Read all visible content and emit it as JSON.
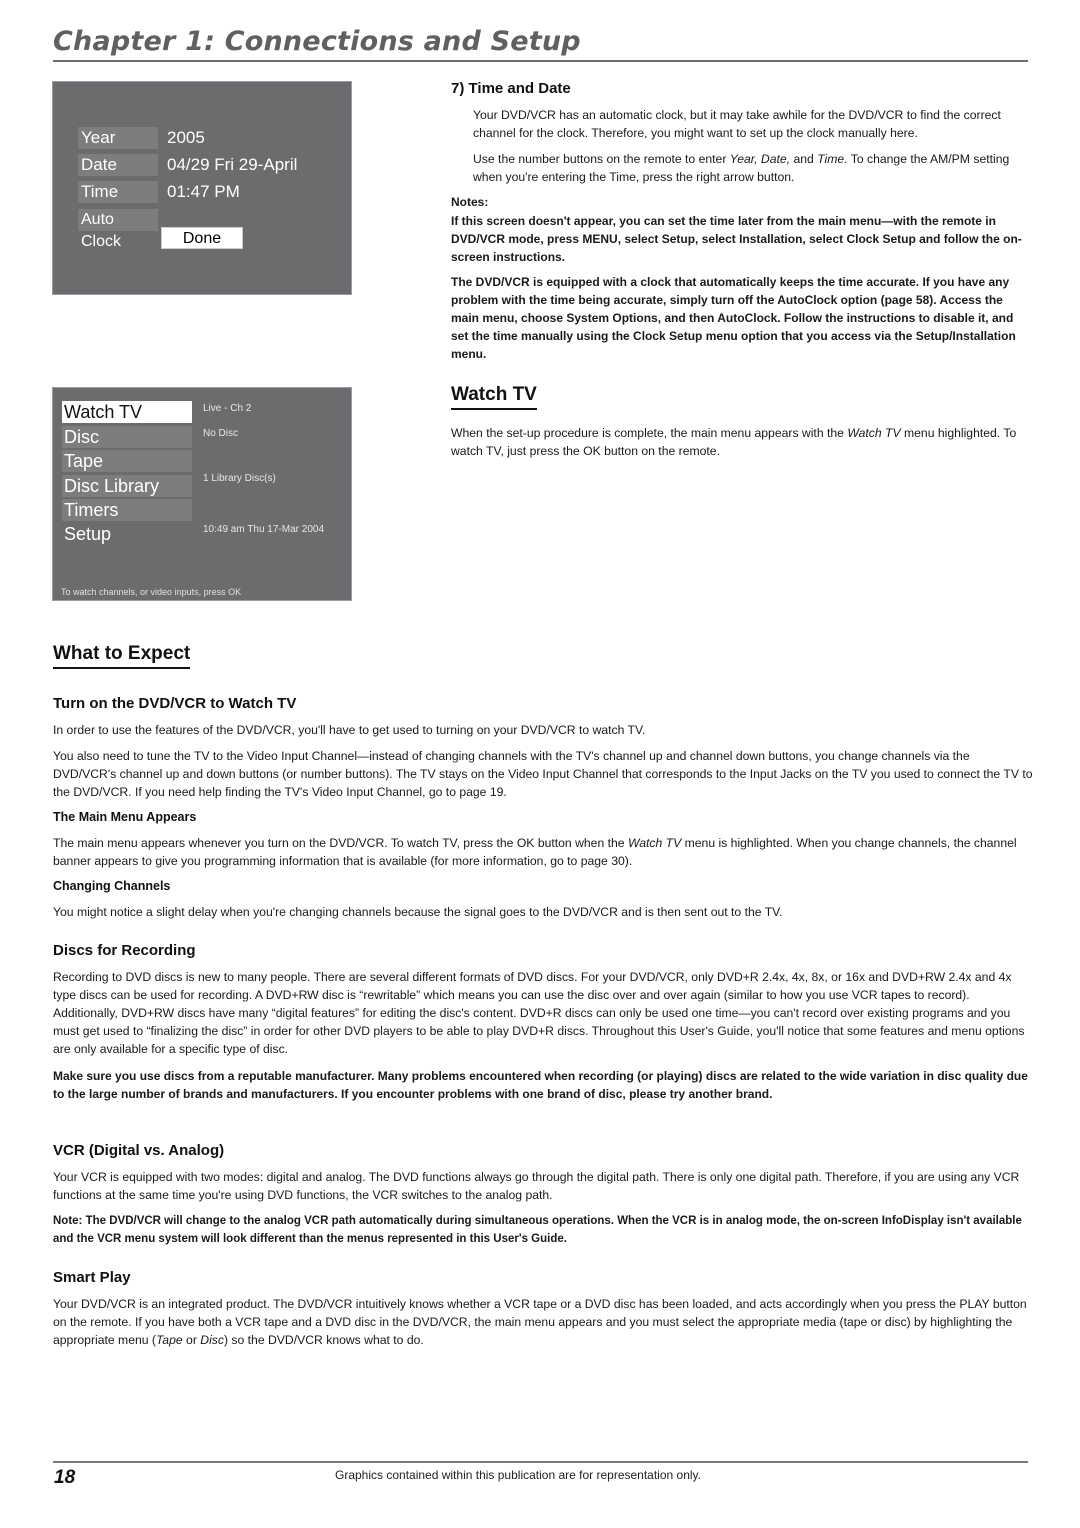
{
  "header": {
    "chapter_title": "Chapter 1: Connections and Setup"
  },
  "clock_screen": {
    "rows": [
      {
        "label": "Year",
        "value": "2005"
      },
      {
        "label": "Date",
        "value": "04/29 Fri 29-April"
      },
      {
        "label": "Time",
        "value": "01:47 PM"
      },
      {
        "label": "Auto Clock",
        "value": ""
      }
    ],
    "done_label": "Done"
  },
  "main_menu_screen": {
    "items": [
      {
        "label": "Watch TV",
        "info": "Live - Ch 2",
        "selected": true
      },
      {
        "label": "Disc",
        "info": "No Disc"
      },
      {
        "label": "Tape",
        "info": ""
      },
      {
        "label": "Disc Library",
        "info": "1 Library Disc(s)"
      },
      {
        "label": "Timers",
        "info": ""
      },
      {
        "label": "Setup",
        "info": "10:49 am Thu 17-Mar 2004"
      }
    ],
    "hint": "To watch channels, or video inputs, press OK"
  },
  "time_and_date": {
    "heading": "7)  Time and Date",
    "p1": "Your DVD/VCR has an automatic clock, but it may take awhile for the DVD/VCR to find the correct channel for the clock. Therefore, you might want to set up the clock manually here.",
    "p2_pre": "Use the number buttons on the remote to enter ",
    "p2_italic": "Year, Date,",
    "p2_mid": " and ",
    "p2_italic2": "Time.",
    "p2_post": " To change the AM/PM setting when you're entering the Time, press the right arrow button.",
    "notes_label": "Notes:",
    "note1": "If this screen doesn't appear, you can set the time later from the main menu—with the remote in DVD/VCR mode, press MENU, select Setup, select Installation, select Clock Setup and follow the on-screen instructions.",
    "note2": "The DVD/VCR is equipped with a clock that automatically keeps the time accurate. If you have any problem with the time being accurate, simply turn off the AutoClock option (page 58). Access the main menu, choose System Options, and then AutoClock. Follow the instructions to disable it, and set the time manually using the Clock Setup menu option that you access via the Setup/Installation menu."
  },
  "watch_tv": {
    "heading": "Watch TV",
    "p_pre": "When the set-up procedure is complete, the main menu appears with the ",
    "p_italic": "Watch TV",
    "p_post": " menu highlighted. To watch TV, just press the OK button on the remote."
  },
  "what_to_expect": {
    "heading": "What to Expect",
    "turn_on": {
      "heading": "Turn on the DVD/VCR to Watch TV",
      "p1": "In order to use the features of the DVD/VCR, you'll have to get used to turning on your DVD/VCR to watch TV.",
      "p2": "You also need to tune the TV to the Video Input Channel—instead of changing channels with the TV's channel up and channel down buttons, you change channels via the DVD/VCR's channel up and down buttons (or number buttons). The TV stays on the Video Input Channel that corresponds to the Input Jacks on the TV you used to connect the TV to the DVD/VCR. If you need help finding the TV's Video Input Channel, go to page 19."
    },
    "main_menu": {
      "heading": "The Main Menu Appears",
      "p_pre": "The main menu appears whenever you turn on the DVD/VCR. To watch TV, press the OK button when the ",
      "p_italic": "Watch TV",
      "p_post": " menu is highlighted. When you change channels, the channel banner appears to give you programming information that is available (for more information, go to page 30)."
    },
    "changing_channels": {
      "heading": "Changing Channels",
      "p": "You might notice a slight delay when you're changing channels because the signal goes to the DVD/VCR and is then sent out to the TV."
    },
    "discs": {
      "heading": "Discs for Recording",
      "p1": "Recording to DVD discs is new to many people. There are several different formats of DVD discs. For your DVD/VCR, only DVD+R 2.4x, 4x, 8x, or 16x and DVD+RW 2.4x and 4x type discs can be used for recording. A DVD+RW disc is “rewritable” which means you can use the disc over and over again (similar to how you use VCR tapes to record). Additionally, DVD+RW discs have many “digital features” for editing the disc's content. DVD+R discs can only be used one time—you can't record over existing programs and you must get used to “finalizing the disc” in order for other DVD players to be able to play DVD+R discs. Throughout this User's Guide, you'll notice that some features and menu options are only available for a specific type of disc.",
      "p2": "Make sure you use discs from a reputable manufacturer. Many problems encountered when recording (or playing) discs are related to the wide variation in disc quality due to the large number of brands and manufacturers. If you encounter problems with one brand of disc, please try another brand."
    },
    "vcr": {
      "heading": "VCR (Digital vs. Analog)",
      "p1": "Your VCR is equipped with two modes: digital and analog. The DVD functions always go through the digital path. There is only one digital path. Therefore, if you are using any VCR functions at the same time you're using DVD functions, the VCR switches to the analog path.",
      "p2": "Note: The DVD/VCR will change to the analog VCR path automatically during simultaneous operations. When the VCR is in analog mode, the on-screen InfoDisplay isn't available and the VCR menu system will look different than the menus represented in this User's Guide."
    },
    "smart_play": {
      "heading": "Smart Play",
      "p_pre": "Your DVD/VCR is an integrated product. The DVD/VCR intuitively knows whether a VCR tape or a DVD disc has been loaded, and acts accordingly when you press the PLAY button on the remote. If you have both a VCR tape and a DVD disc in the DVD/VCR, the main menu appears and you must select the appropriate media (tape or disc) by highlighting the appropriate menu (",
      "p_i1": "Tape",
      "p_mid": " or ",
      "p_i2": "Disc",
      "p_post": ") so the DVD/VCR knows what to do."
    }
  },
  "footer": {
    "page_number": "18",
    "note": "Graphics contained within this publication are for representation only."
  }
}
